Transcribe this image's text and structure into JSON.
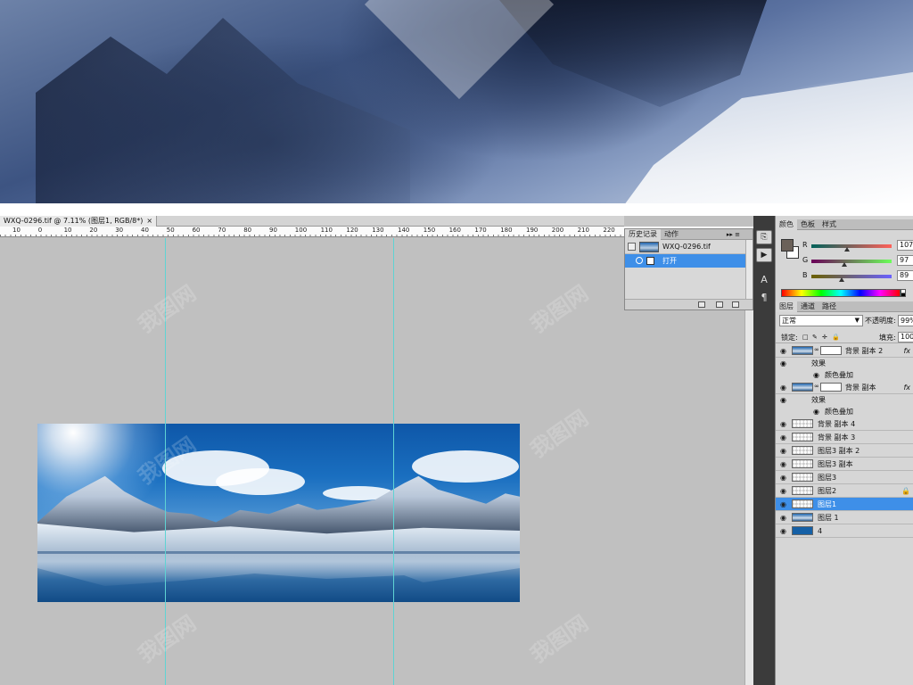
{
  "document": {
    "tab_title": "WXQ-0296.tif @ 7.11% (图层1, RGB/8*)",
    "close_glyph": "×"
  },
  "ruler": {
    "ticks": [
      "10",
      "0",
      "10",
      "20",
      "30",
      "40",
      "50",
      "60",
      "70",
      "80",
      "90",
      "100",
      "110",
      "120",
      "130",
      "140",
      "150",
      "160",
      "170",
      "180",
      "190",
      "200",
      "210",
      "220"
    ]
  },
  "history_panel": {
    "tabs": [
      "历史记录",
      "动作"
    ],
    "menu_glyph": "▸▸ ≡",
    "snapshot_label": "WXQ-0296.tif",
    "states": [
      "打开"
    ]
  },
  "color_panel": {
    "tabs": [
      "颜色",
      "色板",
      "样式"
    ],
    "foreground": "#6b6159",
    "background": "#ffffff",
    "channels": [
      {
        "label": "R",
        "value": "107"
      },
      {
        "label": "G",
        "value": "97"
      },
      {
        "label": "B",
        "value": "89"
      }
    ]
  },
  "layers_panel": {
    "tabs": [
      "图层",
      "通道",
      "路径"
    ],
    "blend_mode": "正常",
    "opacity_label": "不透明度:",
    "opacity_value": "99%",
    "lock_label": "锁定:",
    "fill_label": "填充:",
    "fill_value": "100%",
    "layers": [
      {
        "name": "背景 副本 2",
        "kind": "photo-mask",
        "fx": "fx",
        "effects_label": "效果",
        "effect": "颜色叠加"
      },
      {
        "name": "背景 副本",
        "kind": "photo-mask",
        "fx": "fx",
        "effects_label": "效果",
        "effect": "颜色叠加"
      },
      {
        "name": "背景 副本 4",
        "kind": "transparent"
      },
      {
        "name": "背景 副本 3",
        "kind": "transparent"
      },
      {
        "name": "图层3 副本 2",
        "kind": "transparent"
      },
      {
        "name": "图层3 副本",
        "kind": "transparent"
      },
      {
        "name": "图层3",
        "kind": "transparent"
      },
      {
        "name": "图层2",
        "kind": "transparent",
        "locked": true
      },
      {
        "name": "图层1",
        "kind": "transparent",
        "selected": true
      },
      {
        "name": "图层 1",
        "kind": "photo"
      },
      {
        "name": "4",
        "kind": "solid"
      }
    ]
  },
  "watermark_text": "我图网",
  "colors": {
    "ps_canvas_bg": "#c0c0c0",
    "selection_blue": "#3e8fe8",
    "guide_cyan": "#5fd3d3"
  }
}
